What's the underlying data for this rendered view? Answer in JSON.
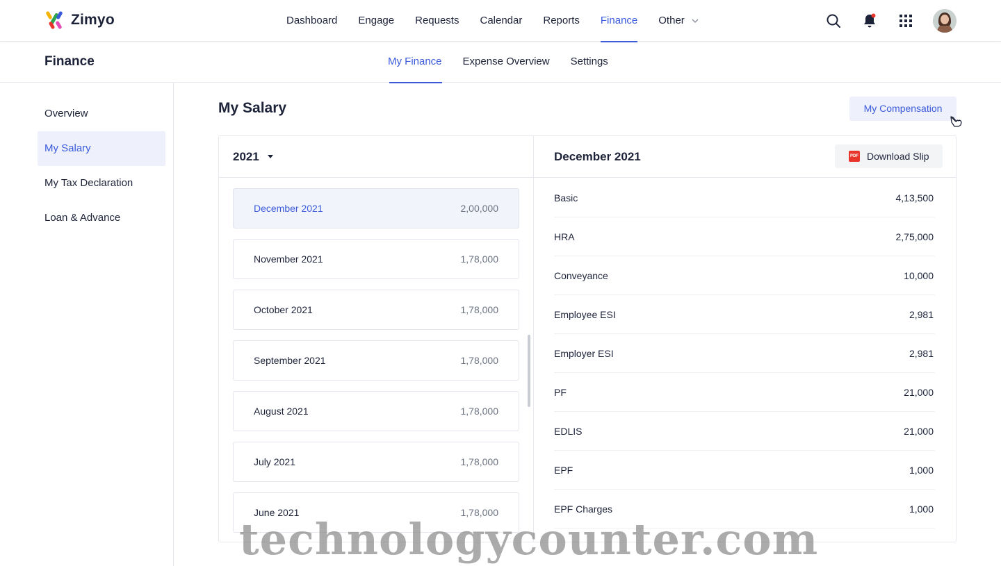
{
  "app": {
    "name": "Zimyo"
  },
  "nav": {
    "items": [
      {
        "label": "Dashboard"
      },
      {
        "label": "Engage"
      },
      {
        "label": "Requests"
      },
      {
        "label": "Calendar"
      },
      {
        "label": "Reports"
      },
      {
        "label": "Finance",
        "active": true
      },
      {
        "label": "Other"
      }
    ]
  },
  "icons": {
    "search": "search-icon",
    "bell": "bell-icon",
    "apps": "apps-grid-icon",
    "avatar": "user-avatar"
  },
  "subheader": {
    "title": "Finance",
    "tabs": [
      {
        "label": "My Finance",
        "active": true
      },
      {
        "label": "Expense Overview"
      },
      {
        "label": "Settings"
      }
    ]
  },
  "sidebar": {
    "items": [
      {
        "label": "Overview"
      },
      {
        "label": "My Salary",
        "active": true
      },
      {
        "label": "My Tax Declaration"
      },
      {
        "label": "Loan & Advance"
      }
    ]
  },
  "main": {
    "title": "My Salary",
    "compensation_button": "My Compensation",
    "year": "2021",
    "months": [
      {
        "name": "December 2021",
        "amount": "2,00,000"
      },
      {
        "name": "November 2021",
        "amount": "1,78,000"
      },
      {
        "name": "October 2021",
        "amount": "1,78,000"
      },
      {
        "name": "September 2021",
        "amount": "1,78,000"
      },
      {
        "name": "August 2021",
        "amount": "1,78,000"
      },
      {
        "name": "July 2021",
        "amount": "1,78,000"
      },
      {
        "name": "June 2021",
        "amount": "1,78,000"
      }
    ],
    "detail": {
      "period": "December 2021",
      "download_label": "Download Slip",
      "pdf_icon_text": "PDF",
      "rows": [
        {
          "label": "Basic",
          "value": "4,13,500"
        },
        {
          "label": "HRA",
          "value": "2,75,000"
        },
        {
          "label": "Conveyance",
          "value": "10,000"
        },
        {
          "label": "Employee ESI",
          "value": "2,981"
        },
        {
          "label": "Employer ESI",
          "value": "2,981"
        },
        {
          "label": "PF",
          "value": "21,000"
        },
        {
          "label": "EDLIS",
          "value": "21,000"
        },
        {
          "label": "EPF",
          "value": "1,000"
        },
        {
          "label": "EPF Charges",
          "value": "1,000"
        }
      ]
    }
  },
  "colors": {
    "accent": "#3b5bdb",
    "active_bg": "#eef1fb",
    "text": "#1c2238",
    "pdf": "#e8342a"
  },
  "watermark": "technologycounter.com"
}
